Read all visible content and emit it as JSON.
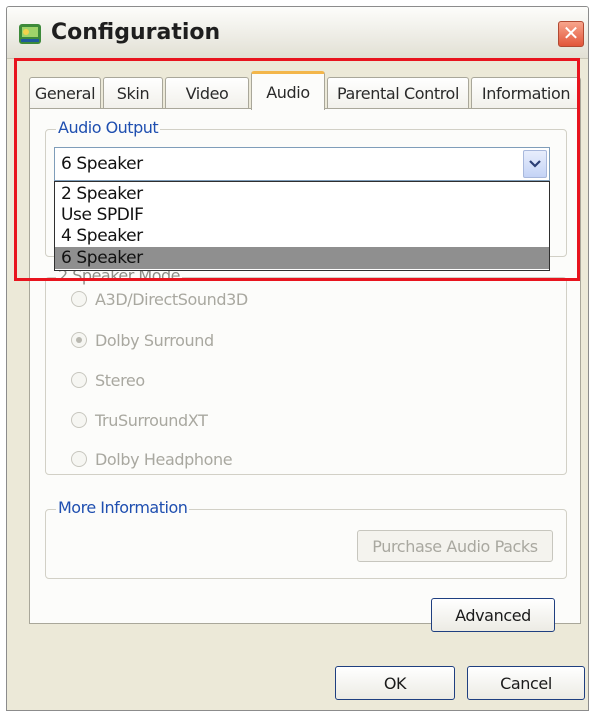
{
  "window": {
    "title": "Configuration",
    "close_glyph": "✕"
  },
  "tabs": [
    {
      "label": "General",
      "active": false
    },
    {
      "label": "Skin",
      "active": false
    },
    {
      "label": "Video",
      "active": false
    },
    {
      "label": "Audio",
      "active": true
    },
    {
      "label": "Parental Control",
      "active": false
    },
    {
      "label": "Information",
      "active": false
    }
  ],
  "audio_output": {
    "legend": "Audio Output",
    "selected": "6 Speaker",
    "options": [
      "2 Speaker",
      "Use SPDIF",
      "4 Speaker",
      "6 Speaker"
    ],
    "highlighted_option": "6 Speaker"
  },
  "speaker_mode": {
    "legend": "2 Speaker Mode",
    "options": [
      {
        "label": "A3D/DirectSound3D",
        "checked": false
      },
      {
        "label": "Dolby Surround",
        "checked": true
      },
      {
        "label": "Stereo",
        "checked": false
      },
      {
        "label": "TruSurroundXT",
        "checked": false
      },
      {
        "label": "Dolby Headphone",
        "checked": false
      }
    ]
  },
  "more_information": {
    "legend": "More Information",
    "purchase_button": "Purchase Audio Packs"
  },
  "buttons": {
    "advanced": "Advanced",
    "ok": "OK",
    "cancel": "Cancel"
  },
  "colors": {
    "window_bg": "#ECE9D8",
    "active_tab_accent": "#F3B64A",
    "annotation_highlight": "#E8141E",
    "dropdown_selection": "#8F8F8F"
  }
}
